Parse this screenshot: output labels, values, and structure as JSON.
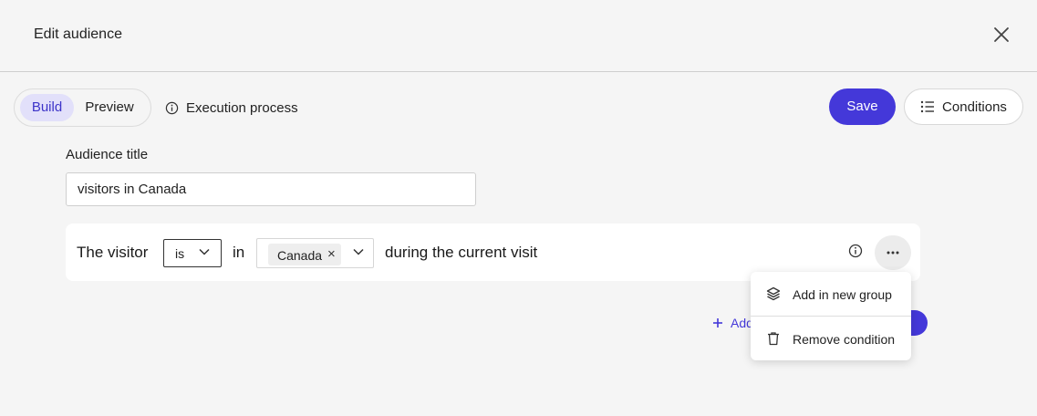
{
  "dialog": {
    "title": "Edit audience"
  },
  "toolbar": {
    "modes": {
      "build": "Build",
      "preview": "Preview",
      "active": "Build"
    },
    "execution_label": "Execution process",
    "save_label": "Save",
    "conditions_label": "Conditions"
  },
  "audience": {
    "title_label": "Audience title",
    "title_value": "visitors in Canada"
  },
  "condition": {
    "subject": "The visitor",
    "operator": "is",
    "connector": "in",
    "values": [
      "Canada"
    ],
    "suffix": "during the current visit"
  },
  "add_link_label": "Add",
  "menu": {
    "items": [
      {
        "label": "Add in new group",
        "icon": "layers-icon"
      },
      {
        "label": "Remove condition",
        "icon": "trash-icon"
      }
    ]
  },
  "colors": {
    "accent": "#4438d9",
    "accent_soft": "#e2e0fa",
    "background": "#f5f5f5"
  }
}
